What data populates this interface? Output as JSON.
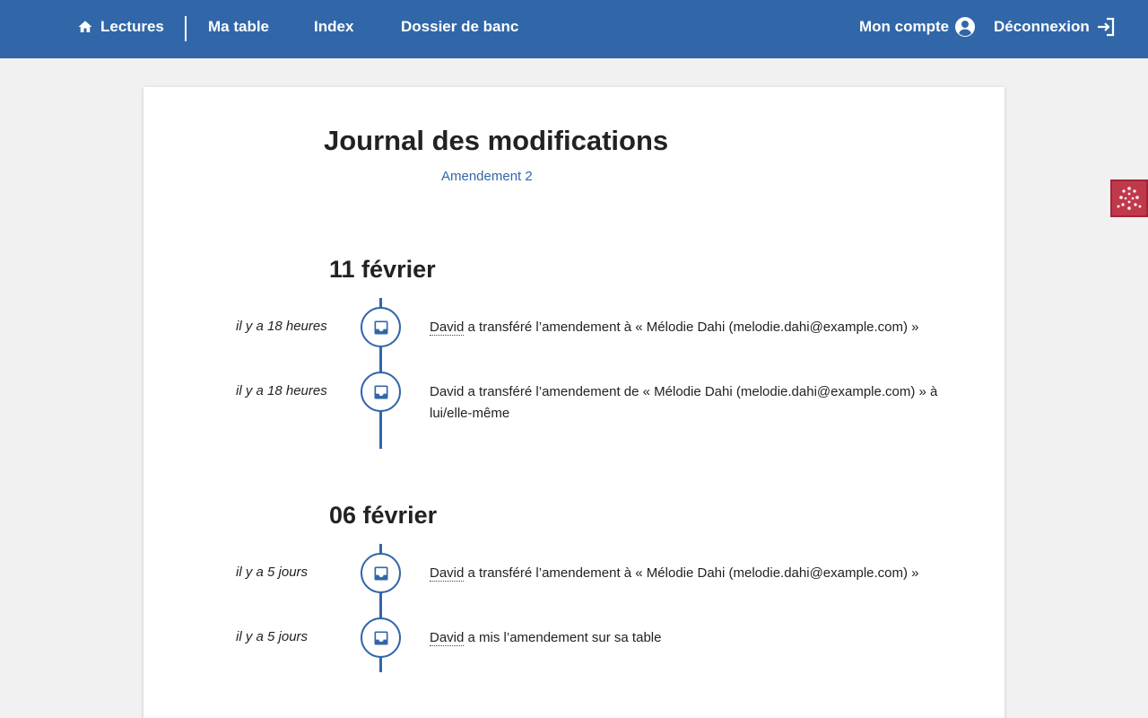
{
  "nav": {
    "home_label": "Lectures",
    "table_label": "Ma table",
    "index_label": "Index",
    "banc_label": "Dossier de banc",
    "account_label": "Mon compte",
    "logout_label": "Déconnexion"
  },
  "page": {
    "title": "Journal des modifications",
    "subtitle_link": "Amendement 2"
  },
  "days": [
    {
      "heading": "11 février",
      "events": [
        {
          "time": "il y a 18 heures",
          "user": "David",
          "text": " a transféré l’amendement à « Mélodie Dahi (melodie.dahi@example.com) »",
          "icon": "inbox-icon"
        },
        {
          "time": "il y a 18 heures",
          "user": "David",
          "text": " a transféré l’amendement de « Mélodie Dahi (melodie.dahi@example.com) » à lui/elle-même",
          "icon": "inbox-icon"
        }
      ]
    },
    {
      "heading": "06 février",
      "events": [
        {
          "time": "il y a 5 jours",
          "user": "David",
          "text": " a transféré l’amendement à « Mélodie Dahi (melodie.dahi@example.com) »",
          "icon": "inbox-icon"
        },
        {
          "time": "il y a 5 jours",
          "user": "David",
          "text": " a mis l’amendement sur sa table",
          "icon": "inbox-icon"
        }
      ]
    }
  ],
  "colors": {
    "brand": "#3167a8",
    "widget": "#c0394b",
    "background": "#f1f1f1"
  }
}
